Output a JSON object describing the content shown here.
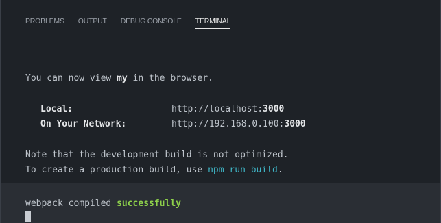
{
  "tabs": [
    {
      "label": "PROBLEMS",
      "active": false
    },
    {
      "label": "OUTPUT",
      "active": false
    },
    {
      "label": "DEBUG CONSOLE",
      "active": false
    },
    {
      "label": "TERMINAL",
      "active": true
    }
  ],
  "terminal": {
    "view_line": {
      "prefix": "You can now view ",
      "app_name": "my",
      "suffix": " in the browser."
    },
    "local": {
      "label": "Local:",
      "url_base": "http://localhost:",
      "port": "3000"
    },
    "network": {
      "label": "On Your Network:",
      "url_base": "http://192.168.0.100:",
      "port": "3000"
    },
    "note_line": "Note that the development build is not optimized.",
    "production_line": {
      "prefix": "To create a production build, use ",
      "command": "npm run build",
      "suffix": "."
    },
    "compiled_line": {
      "prefix": "webpack compiled ",
      "status": "successfully"
    }
  },
  "colors": {
    "background": "#1e2227",
    "command_highlight": "#3fb5c6",
    "success": "#8ed14b"
  }
}
